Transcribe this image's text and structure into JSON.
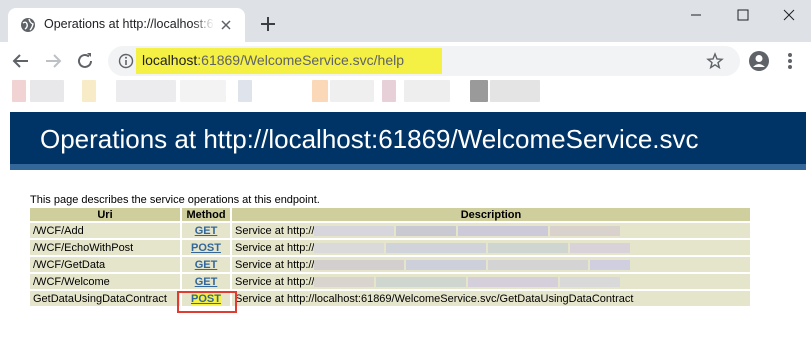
{
  "browser": {
    "tab_title": "Operations at http://localhost:61869/WelcomeService.svc",
    "url_host": "localhost",
    "url_rest": ":61869/WelcomeService.svc/help"
  },
  "page": {
    "heading": "Operations at http://localhost:61869/WelcomeService.svc",
    "description": "This page describes the service operations at this endpoint."
  },
  "table": {
    "headers": [
      "Uri",
      "Method",
      "Description"
    ],
    "rows": [
      {
        "uri": "/WCF/Add",
        "method": "GET",
        "description": "Service at http://"
      },
      {
        "uri": "/WCF/EchoWithPost",
        "method": "POST",
        "description": "Service at http://"
      },
      {
        "uri": "/WCF/GetData",
        "method": "GET",
        "description": "Service at http://"
      },
      {
        "uri": "/WCF/Welcome",
        "method": "GET",
        "description": "Service at http://"
      },
      {
        "uri": "GetDataUsingDataContract",
        "method": "POST",
        "description": "Service at http://localhost:61869/WelcomeService.svc/GetDataUsingDataContract"
      }
    ]
  },
  "colors": {
    "heading_bg": "#003366",
    "heading_border": "#336699",
    "table_header_bg": "#cecf9c",
    "table_cell_bg": "#e5e5cc",
    "highlight_yellow": "#f5f044",
    "annotation_red": "#e03c31"
  }
}
